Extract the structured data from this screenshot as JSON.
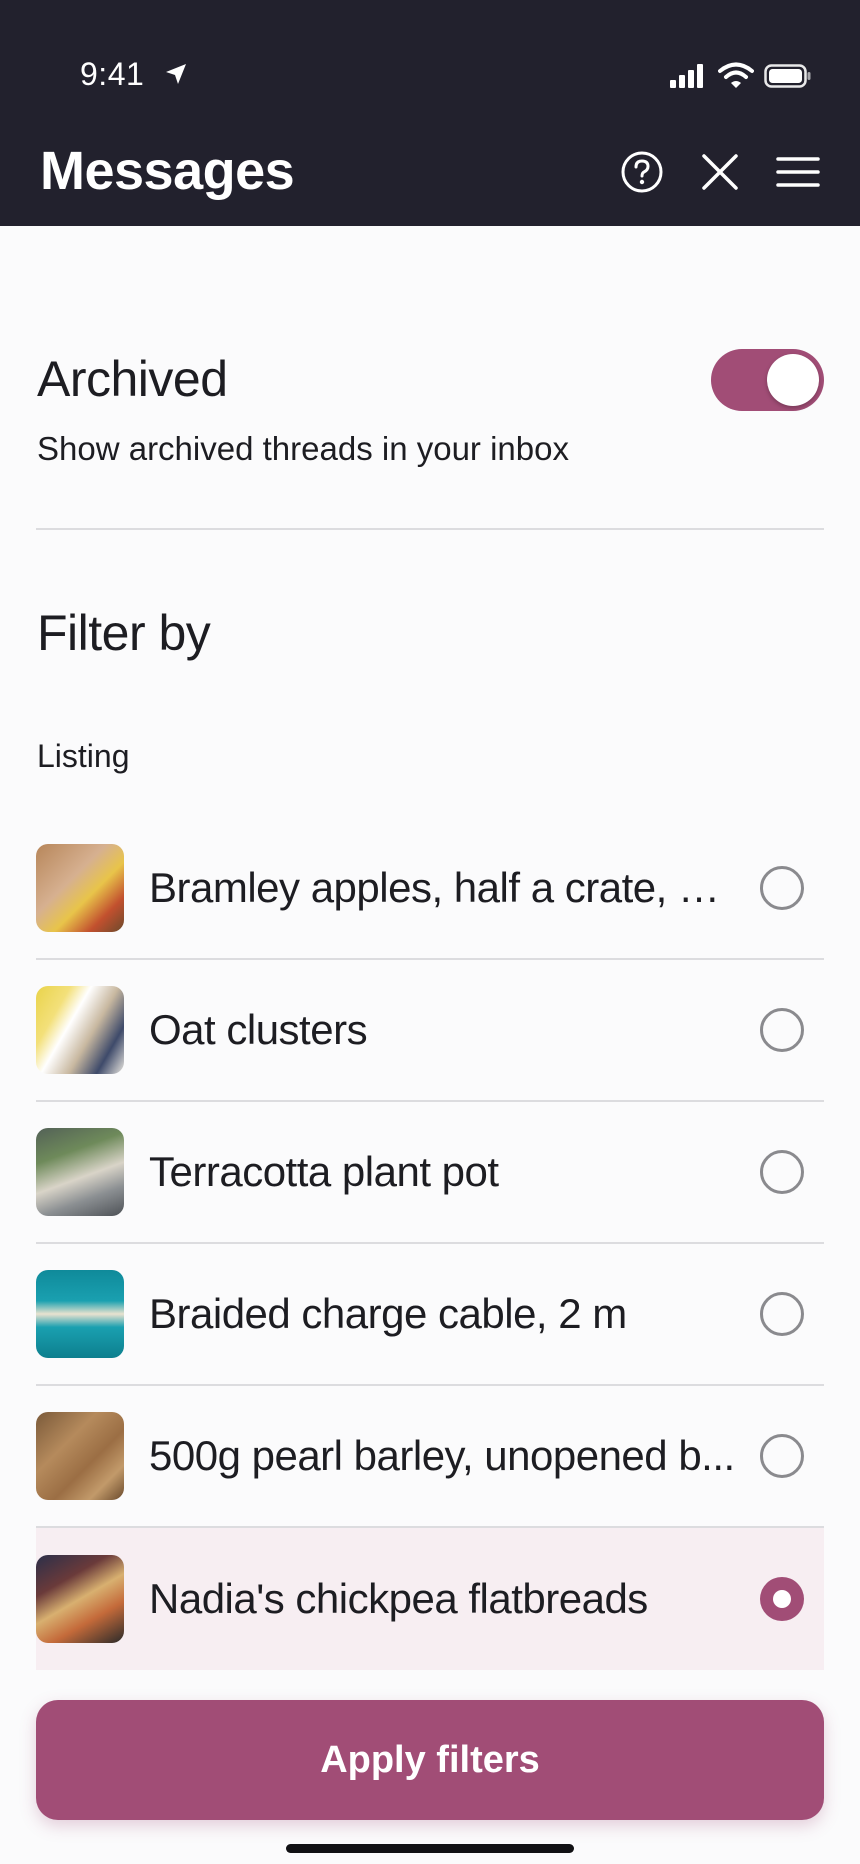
{
  "status_bar": {
    "time": "9:41",
    "icons": [
      "location-arrow-icon",
      "cellular-signal-icon",
      "wifi-icon",
      "battery-icon"
    ]
  },
  "header": {
    "title": "Messages",
    "actions": [
      "help-icon",
      "close-icon",
      "menu-icon"
    ]
  },
  "archived": {
    "title": "Archived",
    "description": "Show archived threads in your inbox",
    "toggle_on": true
  },
  "filter": {
    "title": "Filter by",
    "group_label": "Listing",
    "items": [
      {
        "label": "Bramley apples, half a crate, co...",
        "selected": false
      },
      {
        "label": "Oat clusters",
        "selected": false
      },
      {
        "label": "Terracotta plant pot",
        "selected": false
      },
      {
        "label": "Braided charge cable, 2 m",
        "selected": false
      },
      {
        "label": "500g pearl barley, unopened b...",
        "selected": false
      },
      {
        "label": "Nadia's chickpea flatbreads",
        "selected": true
      }
    ]
  },
  "apply_button": {
    "label": "Apply filters"
  },
  "colors": {
    "header_bg": "#22212d",
    "accent": "#a14d76",
    "selected_row_bg": "#f7eef2",
    "divider": "#dcdcdf"
  }
}
